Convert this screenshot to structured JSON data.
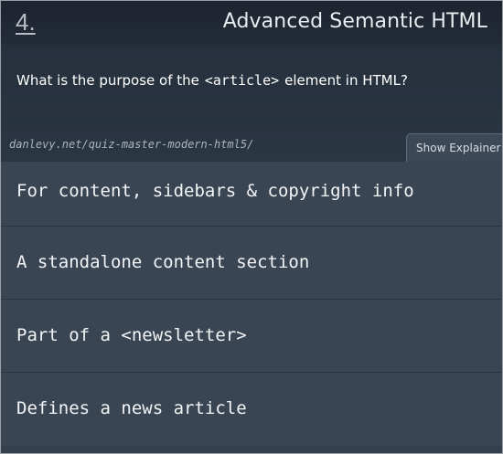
{
  "header": {
    "question_number": "4.",
    "title": "Advanced Semantic HTML"
  },
  "question": {
    "prefix": "What is the purpose of the",
    "code": "<article>",
    "suffix": "element in HTML?",
    "source": "danlevy.net/quiz-master-modern-html5/"
  },
  "explainer_button": {
    "label": "Show Explainer"
  },
  "answers": [
    {
      "label": "For content, sidebars & copyright info"
    },
    {
      "label": "A standalone content section"
    },
    {
      "label": "Part of a <newsletter>"
    },
    {
      "label": "Defines a news article"
    }
  ],
  "colors": {
    "header_bg": "#1d2430",
    "panel_bg": "#34404e",
    "answer_bg": "#3a4553",
    "text": "#ffffff"
  }
}
